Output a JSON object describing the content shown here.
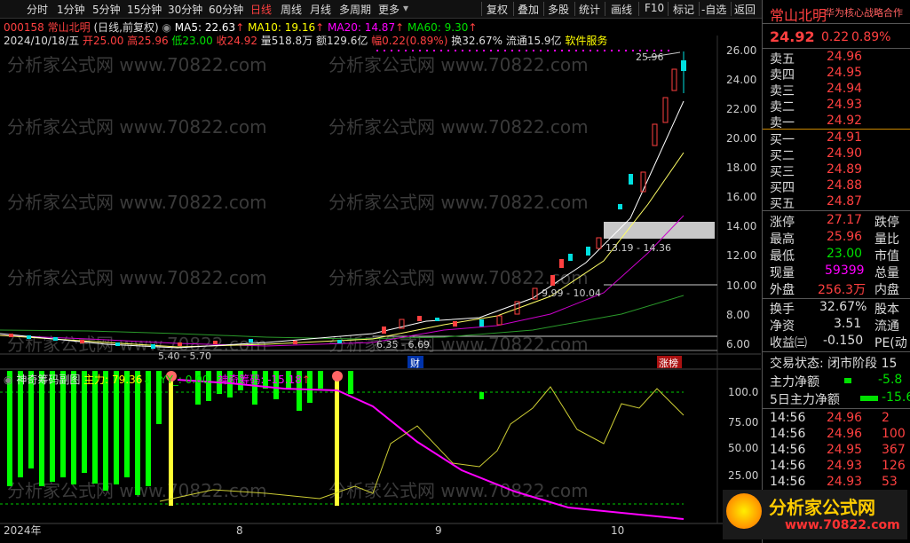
{
  "toolbar": {
    "left": [
      "分时",
      "1分钟",
      "5分钟",
      "15分钟",
      "30分钟",
      "60分钟",
      "日线",
      "周线",
      "月线",
      "多周期",
      "更多"
    ],
    "right": [
      "复权",
      "叠加",
      "多股",
      "统计",
      "画线",
      "F10",
      "标记",
      "-自选",
      "返回"
    ]
  },
  "ma_bar": {
    "code_name": "000158 常山北明",
    "period": "(日线,前复权)",
    "ma5": "MA5: 22.63",
    "ma10": "MA10: 19.16",
    "ma20": "MA20: 14.87",
    "ma60": "MA60: 9.30"
  },
  "quote_bar": {
    "date": "2024/10/18/五",
    "open": "开25.00",
    "high": "高25.96",
    "low": "低23.00",
    "close": "收24.92",
    "vol": "量518.8万",
    "amount": "额129.6亿",
    "amp": "幅0.22(0.89%)",
    "turnover": "换32.67%",
    "float": "流通15.9亿",
    "sector": "软件服务"
  },
  "price_axis": [
    "26.00",
    "24.00",
    "22.00",
    "20.00",
    "18.00",
    "16.00",
    "14.00",
    "12.00",
    "10.00",
    "8.00",
    "6.00"
  ],
  "annotations": {
    "high_label": "25.96",
    "zone1": "13.19 - 14.36",
    "zone2": "9.99 - 10.04",
    "zone3": "6.35 - 6.69",
    "zone4": "5.40 - 5.70",
    "cai": "财",
    "zhangbang": "涨榜"
  },
  "sub_bar": {
    "title": "神奇筹码副图",
    "main": "主力: 79.36",
    "yy": "YY_: 0.00",
    "chip": "神奇筹码: -15.18"
  },
  "sub_axis": [
    "100.0",
    "75.00",
    "50.00",
    "25.00"
  ],
  "time_axis": [
    "2024年",
    "8",
    "9",
    "10"
  ],
  "panel": {
    "title": "常山北明",
    "tag": "华为核心战略合作",
    "price": "24.92",
    "change": "0.22",
    "pct": "0.89%",
    "asks": [
      {
        "l": "卖五",
        "p": "24.96"
      },
      {
        "l": "卖四",
        "p": "24.95"
      },
      {
        "l": "卖三",
        "p": "24.94"
      },
      {
        "l": "卖二",
        "p": "24.93"
      },
      {
        "l": "卖一",
        "p": "24.92"
      }
    ],
    "bids": [
      {
        "l": "买一",
        "p": "24.91"
      },
      {
        "l": "买二",
        "p": "24.90"
      },
      {
        "l": "买三",
        "p": "24.89"
      },
      {
        "l": "买四",
        "p": "24.88"
      },
      {
        "l": "买五",
        "p": "24.87"
      }
    ],
    "stats": [
      {
        "l": "涨停",
        "v": "27.17",
        "c": "red",
        "r": "跌停"
      },
      {
        "l": "最高",
        "v": "25.96",
        "c": "red",
        "r": "量比"
      },
      {
        "l": "最低",
        "v": "23.00",
        "c": "green",
        "r": "市值"
      },
      {
        "l": "现量",
        "v": "59399",
        "c": "mag",
        "r": "总量"
      },
      {
        "l": "外盘",
        "v": "256.3万",
        "c": "red",
        "r": "内盘"
      }
    ],
    "stats2": [
      {
        "l": "换手",
        "v": "32.67%",
        "c": "white",
        "r": "股本"
      },
      {
        "l": "净资",
        "v": "3.51",
        "c": "white",
        "r": "流通"
      },
      {
        "l": "收益㈢",
        "v": "-0.150",
        "c": "white",
        "r": "PE(动"
      }
    ],
    "status": "交易状态: 闭市阶段 15",
    "flow1": {
      "l": "主力净额",
      "v": "-5.8"
    },
    "flow2": {
      "l": "5日主力净额",
      "v": "-15.6"
    },
    "ticks": [
      {
        "t": "14:56",
        "p": "24.96",
        "v": "2"
      },
      {
        "t": "14:56",
        "p": "24.96",
        "v": "100"
      },
      {
        "t": "14:56",
        "p": "24.95",
        "v": "367"
      },
      {
        "t": "14:56",
        "p": "24.93",
        "v": "126"
      },
      {
        "t": "14:56",
        "p": "24.93",
        "v": "53"
      }
    ],
    "logo_text": "分析家公式网",
    "logo_url": "www.70822.com"
  },
  "watermark": "分析家公式网 www.70822.com"
}
